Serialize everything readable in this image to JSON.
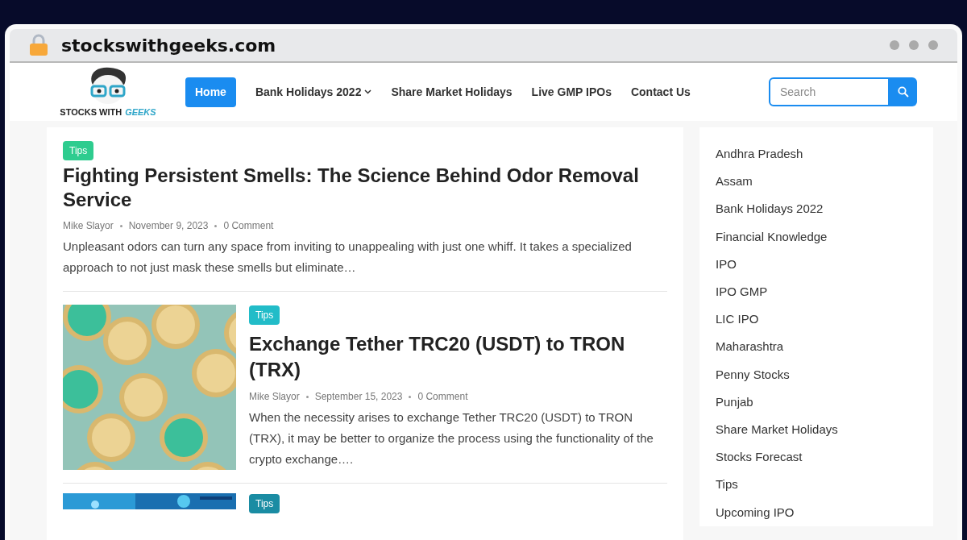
{
  "browser": {
    "address": "stockswithgeeks.com"
  },
  "logo": {
    "line1": "STOCKS WITH",
    "line2": "GEEKS"
  },
  "nav": [
    {
      "label": "Home",
      "selected": true,
      "dropdown": false
    },
    {
      "label": "Bank Holidays 2022",
      "selected": false,
      "dropdown": true
    },
    {
      "label": "Share Market Holidays",
      "selected": false,
      "dropdown": false
    },
    {
      "label": "Live GMP IPOs",
      "selected": false,
      "dropdown": false
    },
    {
      "label": "Contact Us",
      "selected": false,
      "dropdown": false
    }
  ],
  "search": {
    "placeholder": "Search"
  },
  "posts": [
    {
      "kind": "text",
      "category": "Tips",
      "color": "#2ecc8f",
      "title": "Fighting Persistent Smells: The Science Behind Odor Removal Service",
      "author": "Mike Slayor",
      "date": "November 9, 2023",
      "comments": "0 Comment",
      "excerpt": "Unpleasant odors can turn any space from inviting to unappealing with just one whiff. It takes a specialized approach to not just mask these smells but eliminate…"
    },
    {
      "category": "Tips",
      "color": "#22bcc8",
      "title": "Exchange Tether TRC20 (USDT) to TRON (TRX)",
      "author": "Mike Slayor",
      "date": "September 15, 2023",
      "comments": "0 Comment",
      "excerpt": "When the necessity arises to exchange Tether TRC20 (USDT) to TRON (TRX), it may be better to organize the process using the functionality of the crypto exchange…."
    },
    {
      "kind": "image-cut",
      "category": "Tips",
      "color": "#1a8ca3"
    }
  ],
  "sidebar": {
    "items": [
      "Andhra Pradesh",
      "Assam",
      "Bank Holidays 2022",
      "Financial Knowledge",
      "IPO",
      "IPO GMP",
      "LIC IPO",
      "Maharashtra",
      "Penny Stocks",
      "Punjab",
      "Share Market Holidays",
      "Stocks Forecast",
      "Tips",
      "Upcoming IPO"
    ]
  }
}
